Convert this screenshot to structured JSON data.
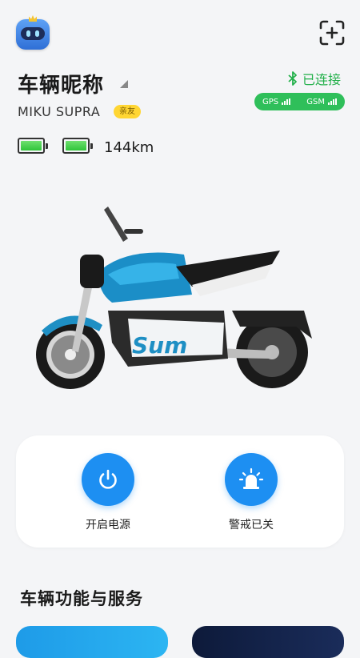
{
  "header": {
    "avatar": "robot-avatar-icon",
    "scan": "add-scan-icon"
  },
  "vehicle": {
    "nickname": "车辆昵称",
    "model": "MIKU SUPRA",
    "badge": "亲友",
    "range": "144km",
    "batteries": [
      {
        "level": 1.0
      },
      {
        "level": 1.0
      }
    ]
  },
  "status": {
    "bluetooth_text": "已连接",
    "gps_label": "GPS",
    "gsm_label": "GSM",
    "accent": "#22b04a"
  },
  "controls": [
    {
      "label": "开启电源",
      "icon": "power-icon"
    },
    {
      "label": "警戒已关",
      "icon": "alarm-siren-icon"
    }
  ],
  "section": {
    "title": "车辆功能与服务"
  },
  "colors": {
    "primary": "#1d8ff2",
    "badge": "#ffd633",
    "battery": "#2fc43a"
  }
}
